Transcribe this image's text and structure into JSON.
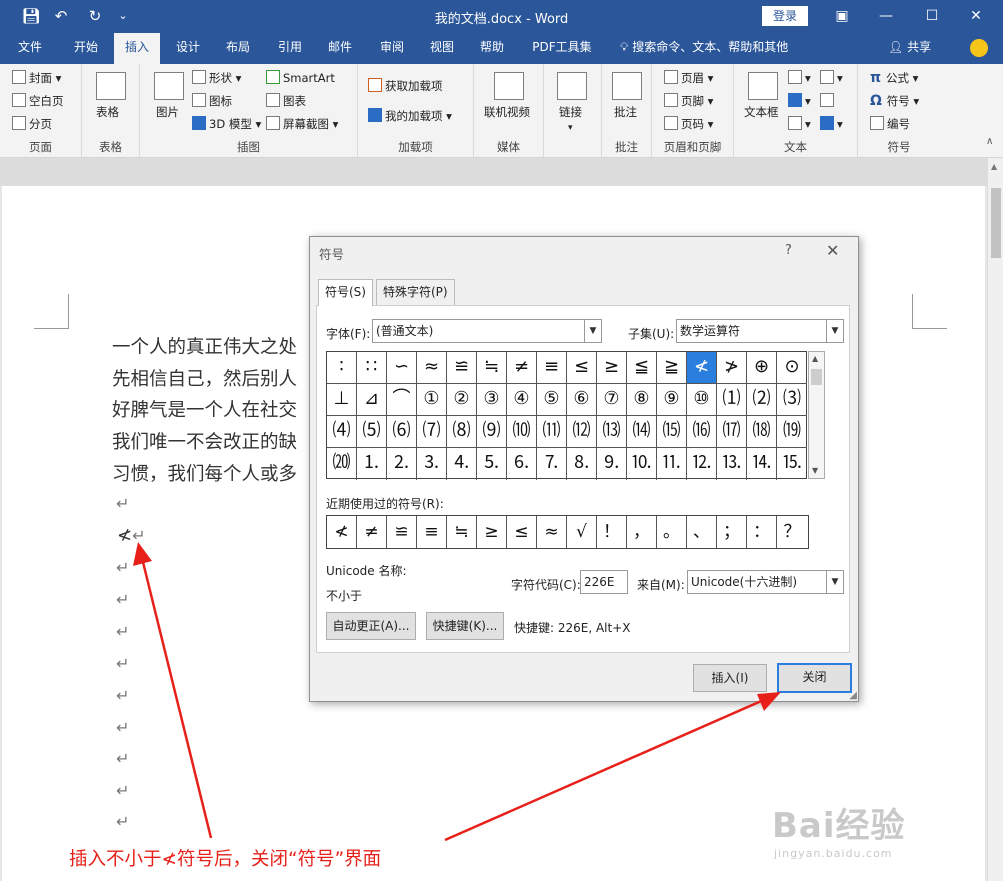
{
  "titlebar": {
    "qat": [
      "save-icon",
      "undo-icon",
      "redo-icon",
      "customize-qat-icon"
    ],
    "title": "我的文档.docx  -  Word",
    "login": "登录",
    "controls": [
      "ribbon-display-icon",
      "minimize-icon",
      "maximize-icon",
      "close-icon"
    ]
  },
  "tabs": {
    "items": [
      "文件",
      "开始",
      "插入",
      "设计",
      "布局",
      "引用",
      "邮件",
      "审阅",
      "视图",
      "帮助",
      "PDF工具集"
    ],
    "active": "插入",
    "search": "搜索命令、文本、帮助和其他",
    "share": "共享"
  },
  "ribbon": {
    "groups": {
      "pages": {
        "label": "页面",
        "cover": "封面",
        "blank": "空白页",
        "break": "分页"
      },
      "tables": {
        "label": "表格",
        "table": "表格"
      },
      "illustrations": {
        "label": "插图",
        "picture": "图片",
        "shapes": "形状",
        "icons": "图标",
        "model3d": "3D 模型",
        "smartart": "SmartArt",
        "chart": "图表",
        "screenshot": "屏幕截图"
      },
      "addins": {
        "label": "加载项",
        "get": "获取加载项",
        "mine": "我的加载项"
      },
      "media": {
        "label": "媒体",
        "video": "联机视频"
      },
      "links": {
        "label": "",
        "link": "链接"
      },
      "comments": {
        "label": "批注",
        "comment": "批注"
      },
      "headerfooter": {
        "label": "页眉和页脚",
        "header": "页眉",
        "footer": "页脚",
        "pagenum": "页码"
      },
      "text": {
        "label": "文本",
        "textbox": "文本框"
      },
      "symbols": {
        "label": "符号",
        "equation": "公式",
        "symbol": "符号",
        "number": "编号"
      }
    }
  },
  "document": {
    "paragraphs": [
      "一个人的真正伟大之处",
      "先相信自己，然后别人",
      "好脾气是一个人在社交",
      "我们唯一不会改正的缺",
      "习惯，我们每个人或多"
    ],
    "inserted_symbol": "≮",
    "para_mark": "↵"
  },
  "dialog": {
    "title": "符号",
    "help": "?",
    "close": "✕",
    "tabs": [
      "符号(S)",
      "特殊字符(P)"
    ],
    "font_label": "字体(F):",
    "font_value": "(普通文本)",
    "subset_label": "子集(U):",
    "subset_value": "数学运算符",
    "grid": [
      [
        "∶",
        "∷",
        "∽",
        "≈",
        "≌",
        "≒",
        "≠",
        "≡",
        "≤",
        "≥",
        "≦",
        "≧",
        "≮",
        "≯",
        "⊕",
        "⊙"
      ],
      [
        "⊥",
        "⊿",
        "⌒",
        "①",
        "②",
        "③",
        "④",
        "⑤",
        "⑥",
        "⑦",
        "⑧",
        "⑨",
        "⑩",
        "⑴",
        "⑵",
        "⑶"
      ],
      [
        "⑷",
        "⑸",
        "⑹",
        "⑺",
        "⑻",
        "⑼",
        "⑽",
        "⑾",
        "⑿",
        "⒀",
        "⒁",
        "⒂",
        "⒃",
        "⒄",
        "⒅",
        "⒆"
      ],
      [
        "⒇",
        "⒈",
        "⒉",
        "⒊",
        "⒋",
        "⒌",
        "⒍",
        "⒎",
        "⒏",
        "⒐",
        "⒑",
        "⒒",
        "⒓",
        "⒔",
        "⒕",
        "⒖"
      ]
    ],
    "selected": "≮",
    "recent_label": "近期使用过的符号(R):",
    "recent": [
      "≮",
      "≠",
      "≌",
      "≡",
      "≒",
      "≥",
      "≤",
      "≈",
      "√",
      "！",
      "，",
      "。",
      "、",
      "；",
      "：",
      "？"
    ],
    "unicode_name_label": "Unicode 名称:",
    "unicode_name": "不小于",
    "char_code_label": "字符代码(C):",
    "char_code": "226E",
    "from_label": "来自(M):",
    "from_value": "Unicode(十六进制)",
    "autocorrect": "自动更正(A)...",
    "shortcut_btn": "快捷键(K)...",
    "shortcut_text": "快捷键: 226E, Alt+X",
    "insert": "插入(I)",
    "close_btn": "关闭"
  },
  "annotation": {
    "text": "插入不小于≮符号后，关闭“符号”界面",
    "color": "#e8201a"
  },
  "watermark": {
    "brand": "Bai经验",
    "url": "jingyan.baidu.com"
  },
  "colors": {
    "accent": "#2b579a",
    "selection": "#2a7fde"
  }
}
